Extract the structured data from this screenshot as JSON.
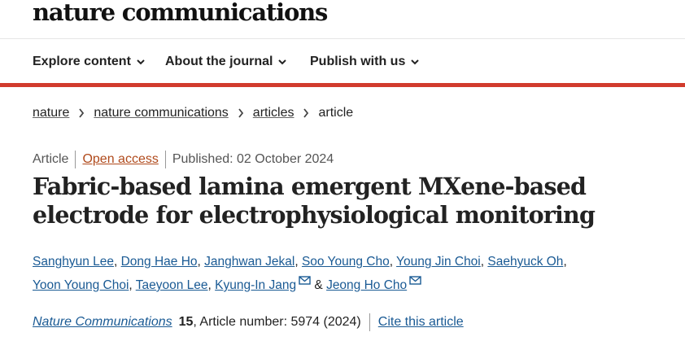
{
  "brand": {
    "name": "nature communications"
  },
  "nav": {
    "items": [
      {
        "label": "Explore content",
        "icon": "chevron-down-icon"
      },
      {
        "label": "About the journal",
        "icon": "chevron-down-icon"
      },
      {
        "label": "Publish with us",
        "icon": "chevron-down-icon"
      }
    ]
  },
  "breadcrumb": {
    "links": [
      "nature",
      "nature communications",
      "articles"
    ],
    "current": "article"
  },
  "meta": {
    "type": "Article",
    "access": "Open access",
    "published": "Published: 02 October 2024"
  },
  "article": {
    "title": "Fabric-based lamina emergent MXene-based electrode for electrophysiological monitoring",
    "authors": [
      "Sanghyun Lee",
      "Dong Hae Ho",
      "Janghwan Jekal",
      "Soo Young Cho",
      "Young Jin Choi",
      "Saehyuck Oh",
      "Yoon Young Choi",
      "Taeyoon Lee",
      "Kyung-In Jang",
      "Jeong Ho Cho"
    ],
    "author_separator": ", ",
    "last_author_joiner": " & "
  },
  "citation": {
    "journal": "Nature Communications",
    "volume": "15",
    "rest": ", Article number: 5974 (2024)",
    "cite_label": "Cite this article"
  },
  "colors": {
    "accent_red": "#d13b2d",
    "link_blue": "#1a5a94",
    "open_access_orange": "#b04a1c"
  }
}
